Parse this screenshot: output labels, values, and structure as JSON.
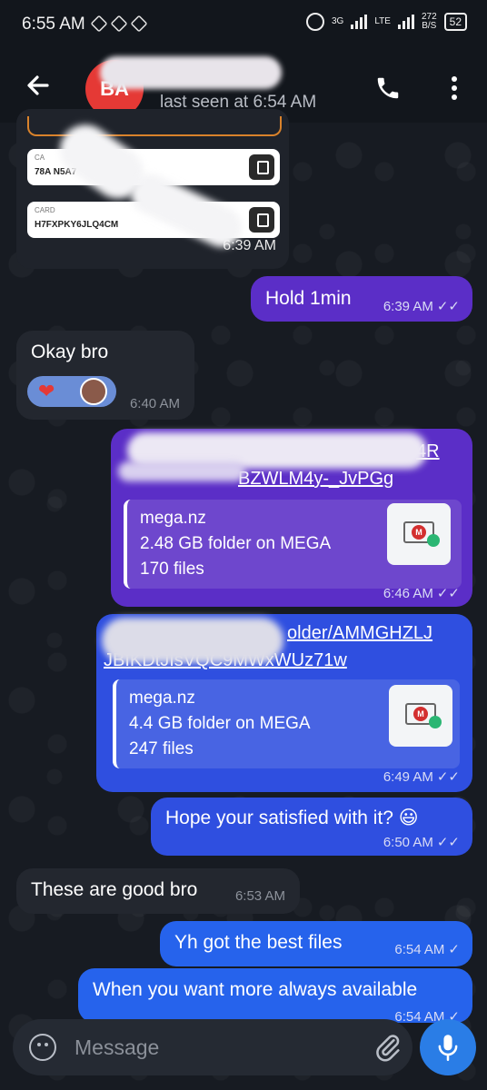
{
  "status_bar": {
    "time": "6:55 AM",
    "network_left": "3G",
    "network_right": "LTE",
    "speed_value": "272",
    "speed_unit": "B/S",
    "battery": "52"
  },
  "header": {
    "avatar_initials": "BA",
    "last_seen": "last seen at 6:54 AM"
  },
  "messages": [
    {
      "id": "card",
      "direction": "in",
      "cards": [
        {
          "label": "CA",
          "value": "78A         N5A7"
        },
        {
          "label": "CARD",
          "value": "H7FXPKY6JLQ4CM"
        }
      ],
      "time": "6:39 AM"
    },
    {
      "id": "m1",
      "direction": "out",
      "text": "Hold 1min",
      "time": "6:39 AM"
    },
    {
      "id": "m2",
      "direction": "in",
      "text": "Okay bro",
      "time": "6:40 AM"
    },
    {
      "id": "m3",
      "direction": "out",
      "link_line1_end": "4R",
      "link_line2": "BZWLM4y-_JvPGg",
      "preview": {
        "site": "mega.nz",
        "title": "2.48 GB folder on MEGA",
        "files": "170 files"
      },
      "time": "6:46 AM"
    },
    {
      "id": "m4",
      "direction": "out",
      "link_line1": "older/AMMGHZLJ",
      "link_line2": "JBIKDtJIsVQC9MWxWUz71w",
      "preview": {
        "site": "mega.nz",
        "title": "4.4 GB folder on MEGA",
        "files": "247 files"
      },
      "time": "6:49 AM"
    },
    {
      "id": "m5",
      "direction": "out",
      "text": "Hope your satisfied with it? 😃",
      "time": "6:50 AM"
    },
    {
      "id": "m6",
      "direction": "in",
      "text": "These are good bro",
      "time": "6:53 AM"
    },
    {
      "id": "m7",
      "direction": "out",
      "text": "Yh got the best files",
      "time": "6:54 AM"
    },
    {
      "id": "m8",
      "direction": "out",
      "text": "When you want more always available",
      "time": "6:54 AM"
    }
  ],
  "input": {
    "placeholder": "Message"
  },
  "colors": {
    "purple_bubble": "#5b2ec7",
    "blue_bubble": "#2f4fe0",
    "incoming_bubble": "#23272f",
    "mic": "#2a7de6",
    "avatar": "#e53935"
  },
  "icons": [
    "back-arrow-icon",
    "phone-icon",
    "more-vert-icon",
    "copy-icon",
    "heart-icon",
    "emoji-icon",
    "attach-icon",
    "mic-icon",
    "double-check-icon",
    "single-check-icon"
  ]
}
